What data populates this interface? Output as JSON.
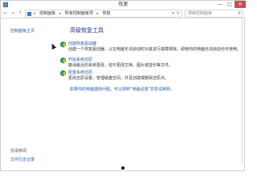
{
  "window": {
    "title": "恢复",
    "min": "—",
    "max": "□",
    "close": "✕"
  },
  "address": {
    "back": "←",
    "forward": "→",
    "up": "↑",
    "crumbs": [
      "控制面板",
      "所有控制面板项",
      "恢复"
    ],
    "separator": "▸",
    "dropdown": "▾",
    "refresh": "↻",
    "search_placeholder": "搜索控制面板",
    "search_icon": "⚲"
  },
  "left": {
    "home_link": "控制面板主页",
    "see_also": "另请参阅",
    "file_history": "文件历史记录"
  },
  "main": {
    "heading": "高级恢复工具",
    "items": [
      {
        "icon": "shield-icon",
        "link": "创建恢复驱动器",
        "desc": "创建一个恢复驱动器，以在电脑无法启动时对其进行故障排除。即使你的电脑无法启动也可使用。"
      },
      {
        "icon": "shield-icon",
        "link": "开始系统还原",
        "desc": "撤消最近的系统更改，但不更改文档、图片或音乐等文件。"
      },
      {
        "icon": "shield-icon",
        "link": "配置系统还原",
        "desc": "更改还原设置，管理磁盘空间，并且创建或删除还原点。"
      }
    ],
    "footer_link": "如果你的电脑遇到问题，可以转到“电脑设置”并尝试刷新。"
  }
}
